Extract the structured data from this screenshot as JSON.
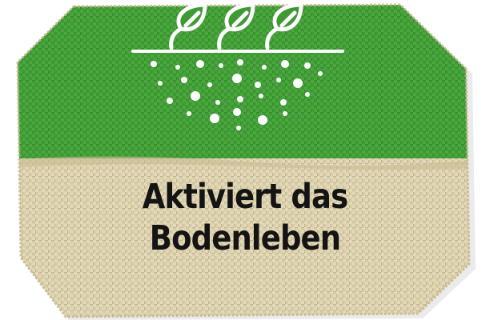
{
  "badge": {
    "line1": "Aktiviert das",
    "line2": "Bodenleben",
    "icon": "plants-soil-life-icon",
    "colors": {
      "green": "#3f9a35",
      "burlap": "#d8cda9",
      "text": "#141414",
      "icon": "#ffffff"
    }
  }
}
